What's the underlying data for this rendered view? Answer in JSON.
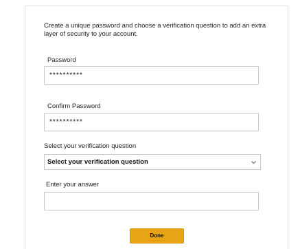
{
  "intro_text": "Create a unique password and choose a verification question to add an extra layer of security to your account.",
  "password": {
    "label": "Password",
    "value": "**********"
  },
  "confirm_password": {
    "label": "Confirm Password",
    "value": "**********"
  },
  "verification": {
    "label": "Select your verification question",
    "selected": "Select your verification question",
    "icon": "chevron-down-icon"
  },
  "answer": {
    "label": "Enter your answer",
    "value": ""
  },
  "done_label": "Done",
  "colors": {
    "accent": "#e8a317",
    "border": "#c8c8c8"
  }
}
